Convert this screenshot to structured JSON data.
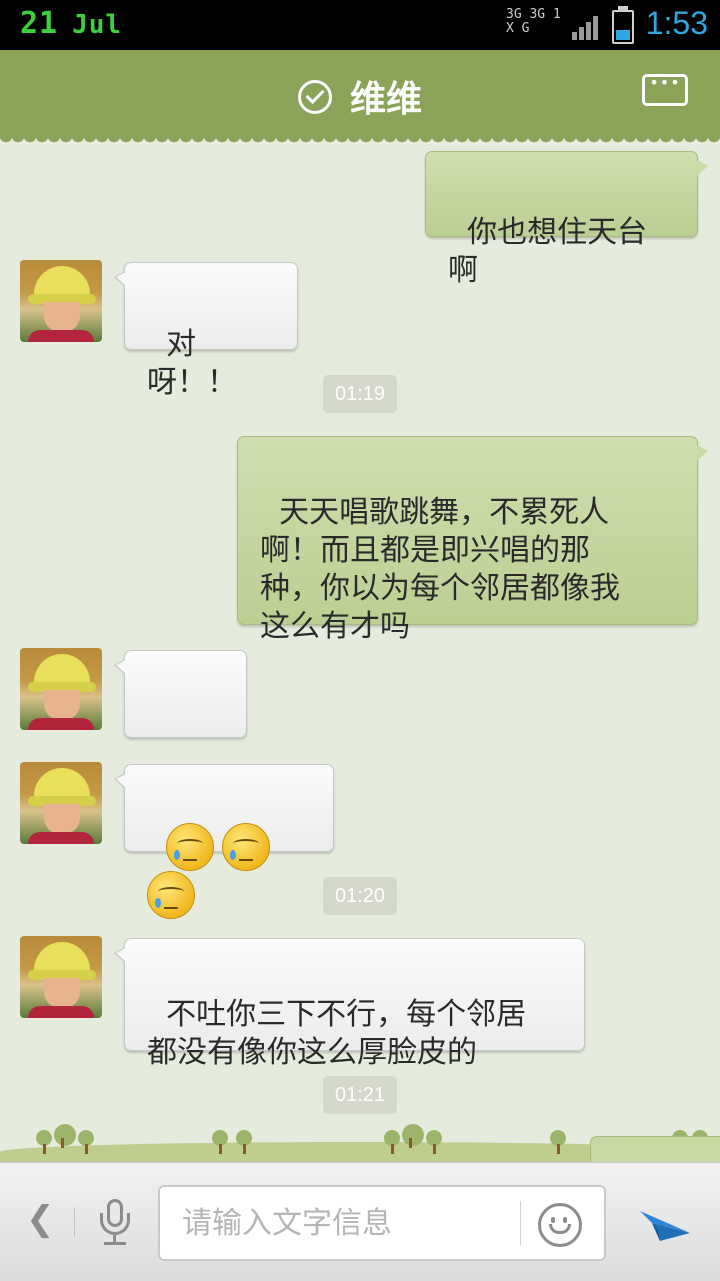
{
  "status_bar": {
    "date_day": "21",
    "date_month": "Jul",
    "network": "3G 3G 1X G",
    "battery_level": 0.35,
    "time": "1:53",
    "time_color": "#2fa7e0",
    "date_color": "#3bd13b"
  },
  "header": {
    "title": "维维",
    "status_icon": "check-circle-icon",
    "menu_icon": "more-options-icon",
    "color": "#8aa359"
  },
  "messages": [
    {
      "side": "right",
      "text": "你也想住天台啊"
    },
    {
      "side": "left",
      "text": "对呀！！"
    },
    {
      "type": "timestamp",
      "text": "01:19"
    },
    {
      "side": "right",
      "text": "天天唱歌跳舞，不累死人\n啊！而且都是即兴唱的那\n种，你以为每个邻居都像我\n这么有才吗"
    },
    {
      "side": "left",
      "text": "→_→"
    },
    {
      "side": "left",
      "type": "emoji",
      "emoji": "crying-face",
      "count": 3
    },
    {
      "type": "timestamp",
      "text": "01:20"
    },
    {
      "side": "left",
      "text": "不吐你三下不行，每个邻居\n都没有像你这么厚脸皮的"
    },
    {
      "type": "timestamp",
      "text": "01:21"
    }
  ],
  "input_bar": {
    "placeholder": "请输入文字信息",
    "value": "",
    "back_icon": "chevron-left-icon",
    "voice_icon": "microphone-icon",
    "emoji_icon": "smiley-icon",
    "send_icon": "paper-plane-icon",
    "send_color": "#2f86d6"
  }
}
